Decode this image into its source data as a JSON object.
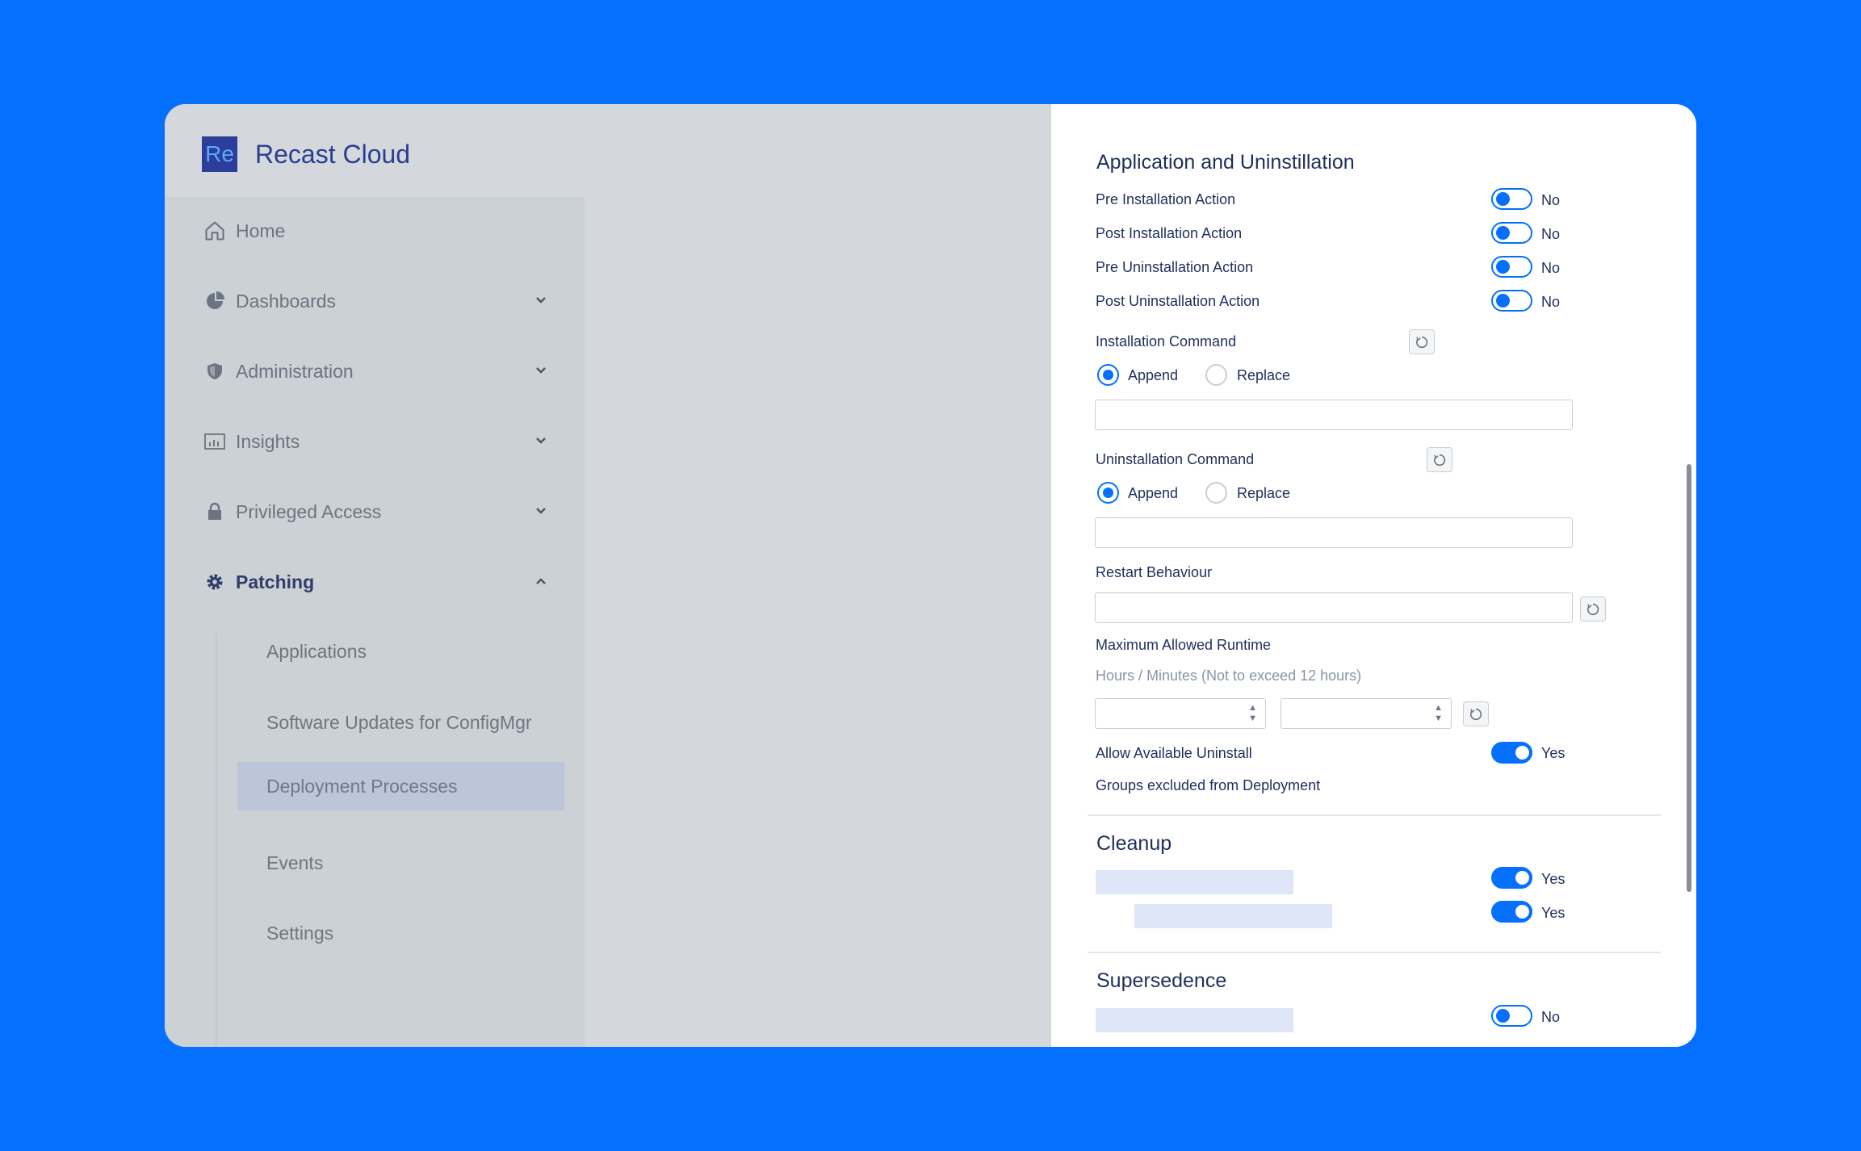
{
  "brand": {
    "logo": "Re",
    "name": "Recast Cloud"
  },
  "nav": {
    "home": "Home",
    "dashboards": "Dashboards",
    "administration": "Administration",
    "insights": "Insights",
    "privileged_access": "Privileged Access",
    "patching": "Patching"
  },
  "subnav": {
    "applications": "Applications",
    "software_updates": "Software Updates for ConfigMgr",
    "deployment_processes": "Deployment Processes",
    "events": "Events",
    "settings": "Settings"
  },
  "app_section": {
    "title": "Application and Uninstillation",
    "rows": [
      {
        "label": "Pre Installation Action",
        "state": "No"
      },
      {
        "label": "Post Installation Action",
        "state": "No"
      },
      {
        "label": "Pre Uninstallation Action",
        "state": "No"
      },
      {
        "label": "Post Uninstallation Action",
        "state": "No"
      }
    ],
    "installation_command": "Installation Command",
    "uninstallation_command": "Uninstallation Command",
    "append": "Append",
    "replace": "Replace",
    "restart_behaviour": "Restart Behaviour",
    "max_runtime": "Maximum Allowed Runtime",
    "max_runtime_hint": "Hours / Minutes (Not to exceed 12 hours)",
    "allow_uninstall": "Allow Available Uninstall",
    "allow_uninstall_state": "Yes",
    "groups_excluded": "Groups excluded from Deployment"
  },
  "cleanup": {
    "title": "Cleanup",
    "states": [
      "Yes",
      "Yes"
    ]
  },
  "supersedence": {
    "title": "Supersedence",
    "states": [
      "No"
    ]
  },
  "colors": {
    "accent": "#0570fe",
    "text": "#1f2f5c",
    "brand": "#2c3e9a"
  }
}
